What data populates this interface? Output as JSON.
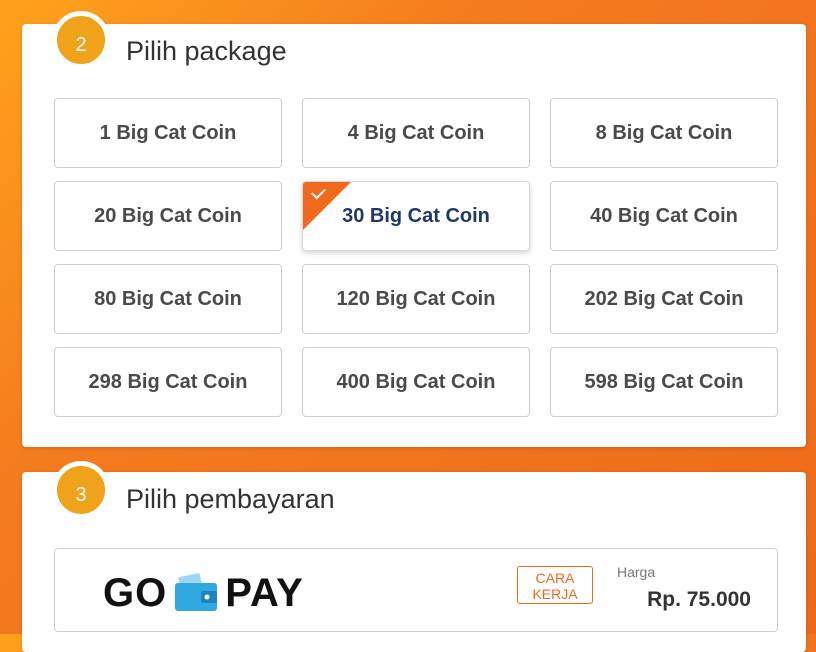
{
  "package_section": {
    "step_number": "2",
    "title": "Pilih package",
    "packages": [
      {
        "label": "1 Big Cat Coin",
        "selected": false
      },
      {
        "label": "4 Big Cat Coin",
        "selected": false
      },
      {
        "label": "8 Big Cat Coin",
        "selected": false
      },
      {
        "label": "20 Big Cat Coin",
        "selected": false
      },
      {
        "label": "30 Big Cat Coin",
        "selected": true
      },
      {
        "label": "40 Big Cat Coin",
        "selected": false
      },
      {
        "label": "80 Big Cat Coin",
        "selected": false
      },
      {
        "label": "120 Big Cat Coin",
        "selected": false
      },
      {
        "label": "202 Big Cat Coin",
        "selected": false
      },
      {
        "label": "298 Big Cat Coin",
        "selected": false
      },
      {
        "label": "400 Big Cat Coin",
        "selected": false
      },
      {
        "label": "598 Big Cat Coin",
        "selected": false
      }
    ],
    "selected_icon": "check-icon"
  },
  "payment_section": {
    "step_number": "3",
    "title": "Pilih pembayaran",
    "option": {
      "logo_text_left": "GO",
      "logo_text_right": "PAY",
      "logo_icon": "wallet-icon",
      "how_it_works_line1": "CARA",
      "how_it_works_line2": "KERJA",
      "price_label": "Harga",
      "price_value": "Rp. 75.000"
    }
  },
  "colors": {
    "accent_orange": "#ef6a1c",
    "badge_orange": "#f0a21a",
    "selected_text": "#1f3a66",
    "gopay_blue": "#2fa9e0"
  }
}
